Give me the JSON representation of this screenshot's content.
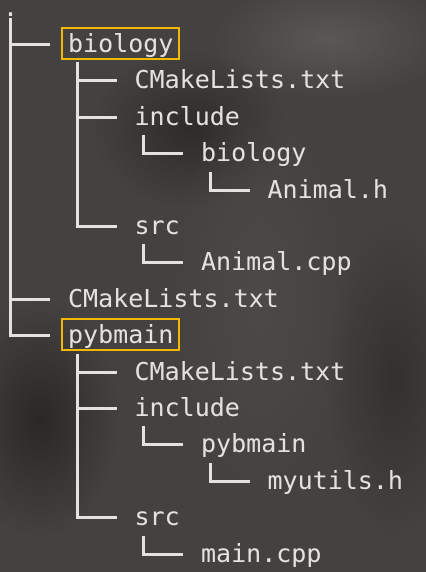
{
  "root": ".",
  "accent": "#f5b800",
  "rows": [
    {
      "label": "biology",
      "depth": 0,
      "last": false,
      "highlighted": true
    },
    {
      "label": "CMakeLists.txt",
      "depth": 1,
      "last": false,
      "highlighted": false
    },
    {
      "label": "include",
      "depth": 1,
      "last": false,
      "highlighted": false
    },
    {
      "label": "biology",
      "depth": 2,
      "last": true,
      "highlighted": false
    },
    {
      "label": "Animal.h",
      "depth": 3,
      "last": true,
      "highlighted": false
    },
    {
      "label": "src",
      "depth": 1,
      "last": true,
      "highlighted": false
    },
    {
      "label": "Animal.cpp",
      "depth": 2,
      "last": true,
      "highlighted": false
    },
    {
      "label": "CMakeLists.txt",
      "depth": 0,
      "last": false,
      "highlighted": false
    },
    {
      "label": "pybmain",
      "depth": 0,
      "last": true,
      "highlighted": true
    },
    {
      "label": "CMakeLists.txt",
      "depth": 1,
      "last": false,
      "highlighted": false
    },
    {
      "label": "include",
      "depth": 1,
      "last": false,
      "highlighted": false
    },
    {
      "label": "pybmain",
      "depth": 2,
      "last": true,
      "highlighted": false
    },
    {
      "label": "myutils.h",
      "depth": 3,
      "last": true,
      "highlighted": false
    },
    {
      "label": "src",
      "depth": 1,
      "last": true,
      "highlighted": false
    },
    {
      "label": "main.cpp",
      "depth": 2,
      "last": true,
      "highlighted": false
    }
  ]
}
